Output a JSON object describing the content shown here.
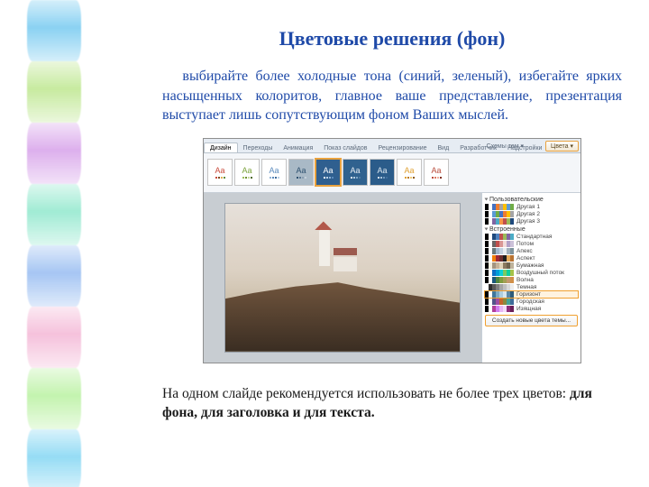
{
  "title": "Цветовые решения (фон)",
  "body": "выбирайте более холодные тона (синий, зеленый), избегайте ярких насыщенных колоритов, главное ваше представление, презентация выступает лишь сопутствующим фоном Ваших мыслей.",
  "caption_plain": "На одном слайде рекомендуется использовать не более трех цветов: ",
  "caption_bold": "для фона, для заголовка и для текста.",
  "rail_colors": [
    "#6cc6ef",
    "#b9e587",
    "#d49be8",
    "#88e6c9",
    "#8fb7f0",
    "#f3b2d3",
    "#b4f09a",
    "#7ad3f2"
  ],
  "ppt": {
    "tabs": [
      "Дизайн",
      "Переходы",
      "Анимация",
      "Показ слайдов",
      "Рецензирование",
      "Вид",
      "Разработчик",
      "Надстройки"
    ],
    "active_tab": 0,
    "top_badge": "Цвета ▾",
    "schemes_hint": "Схемы тем ▾",
    "themes": [
      {
        "bg": "#ffffff",
        "fg": "#c94a3b",
        "accents": [
          "#c94a3b",
          "#7c4a1e",
          "#e0b050",
          "#5f8b3c"
        ]
      },
      {
        "bg": "#ffffff",
        "fg": "#7aa23a",
        "accents": [
          "#9cbf5a",
          "#6f8f34",
          "#c8da9a",
          "#4e6a25"
        ]
      },
      {
        "bg": "#ffffff",
        "fg": "#5b8bbd",
        "accents": [
          "#8fb2d6",
          "#5b8bbd",
          "#3c6a9b",
          "#b8d0e6"
        ]
      },
      {
        "bg": "#a9b9c6",
        "fg": "#2d506f",
        "accents": [
          "#2d506f",
          "#5b7793",
          "#8a9fb2",
          "#c4d0db"
        ]
      },
      {
        "bg": "#2f5f8f",
        "fg": "#ffffff",
        "accents": [
          "#ffffff",
          "#bcd3e8",
          "#8fb2d6",
          "#5b8bbd"
        ],
        "sel": true
      },
      {
        "bg": "#30628f",
        "fg": "#e8eef4",
        "accents": [
          "#e8eef4",
          "#b5cde0",
          "#7fa6c6",
          "#4f7aa0"
        ]
      },
      {
        "bg": "#2b5c8a",
        "fg": "#dce7f0",
        "accents": [
          "#dce7f0",
          "#a9c4da",
          "#6f97bc",
          "#3f6e9b"
        ]
      },
      {
        "bg": "#ffffff",
        "fg": "#e0a030",
        "accents": [
          "#e0a030",
          "#b87820",
          "#f0c870",
          "#8c5a10"
        ]
      },
      {
        "bg": "#ffffff",
        "fg": "#b84a3a",
        "accents": [
          "#b84a3a",
          "#e07a60",
          "#f0b0a0",
          "#803020"
        ]
      }
    ],
    "panel": {
      "sec1": {
        "title": "Пользовательские",
        "items": [
          {
            "label": "Другая 1",
            "c": [
              "#000",
              "#fff",
              "#4472c4",
              "#ed7d31",
              "#a5a5a5",
              "#ffc000",
              "#5b9bd5",
              "#70ad47"
            ]
          },
          {
            "label": "Другая 2",
            "c": [
              "#000",
              "#fff",
              "#5b9bd5",
              "#70ad47",
              "#4472c4",
              "#ed7d31",
              "#ffc000",
              "#a5a5a5"
            ]
          },
          {
            "label": "Другая 3",
            "c": [
              "#000",
              "#fff",
              "#8064a2",
              "#4bacc6",
              "#f79646",
              "#c0504d",
              "#9bbb59",
              "#1f497d"
            ]
          }
        ]
      },
      "sec2": {
        "title": "Встроенные",
        "items": [
          {
            "label": "Стандартная",
            "c": [
              "#000",
              "#fff",
              "#1f497d",
              "#4f81bd",
              "#c0504d",
              "#9bbb59",
              "#8064a2",
              "#4bacc6"
            ]
          },
          {
            "label": "Потом",
            "c": [
              "#000",
              "#fff",
              "#696464",
              "#c0504d",
              "#d99694",
              "#f2dcdb",
              "#b2a1c7",
              "#ccc1d9"
            ]
          },
          {
            "label": "Апекс",
            "c": [
              "#000",
              "#fff",
              "#67787b",
              "#9fb8cd",
              "#c2d1e0",
              "#e8edf0",
              "#a0b0bb",
              "#7e939d"
            ]
          },
          {
            "label": "Аспект",
            "c": [
              "#000",
              "#fff",
              "#f07f09",
              "#9f2936",
              "#6b2e2e",
              "#1e1e1e",
              "#e3a857",
              "#b87333"
            ]
          },
          {
            "label": "Бумажная",
            "c": [
              "#000",
              "#f5f0e1",
              "#a39480",
              "#c7b299",
              "#e0d3b8",
              "#8a7a5f",
              "#6e624c",
              "#beb29a"
            ]
          },
          {
            "label": "Воздушный поток",
            "c": [
              "#000",
              "#fff",
              "#0f6fc6",
              "#009dd9",
              "#0bd0d9",
              "#7cca62",
              "#10cf9b",
              "#a5c249"
            ]
          },
          {
            "label": "Волна",
            "c": [
              "#000",
              "#fff",
              "#1b587c",
              "#4e8542",
              "#7e9c40",
              "#a39f55",
              "#c3986d",
              "#d19049"
            ]
          },
          {
            "label": "Темная",
            "c": [
              "#fff",
              "#2f2f2f",
              "#595959",
              "#7f7f7f",
              "#a5a5a5",
              "#bfbfbf",
              "#d8d8d8",
              "#ededed"
            ]
          },
          {
            "label": "Горизонт",
            "c": [
              "#000",
              "#fff",
              "#40769c",
              "#7daac3",
              "#aecee0",
              "#d8e7f0",
              "#5c8aa8",
              "#2e5a7a"
            ],
            "sel": true
          },
          {
            "label": "Городская",
            "c": [
              "#000",
              "#fff",
              "#53548a",
              "#a04da3",
              "#c4652d",
              "#8b8940",
              "#45a296",
              "#3d6b99"
            ]
          },
          {
            "label": "Изящная",
            "c": [
              "#000",
              "#fff",
              "#b13f9a",
              "#d17df0",
              "#e8b5f5",
              "#f3dcf9",
              "#8e2f7a",
              "#6a2059"
            ]
          }
        ]
      },
      "button": "Создать новые цвета темы..."
    }
  }
}
